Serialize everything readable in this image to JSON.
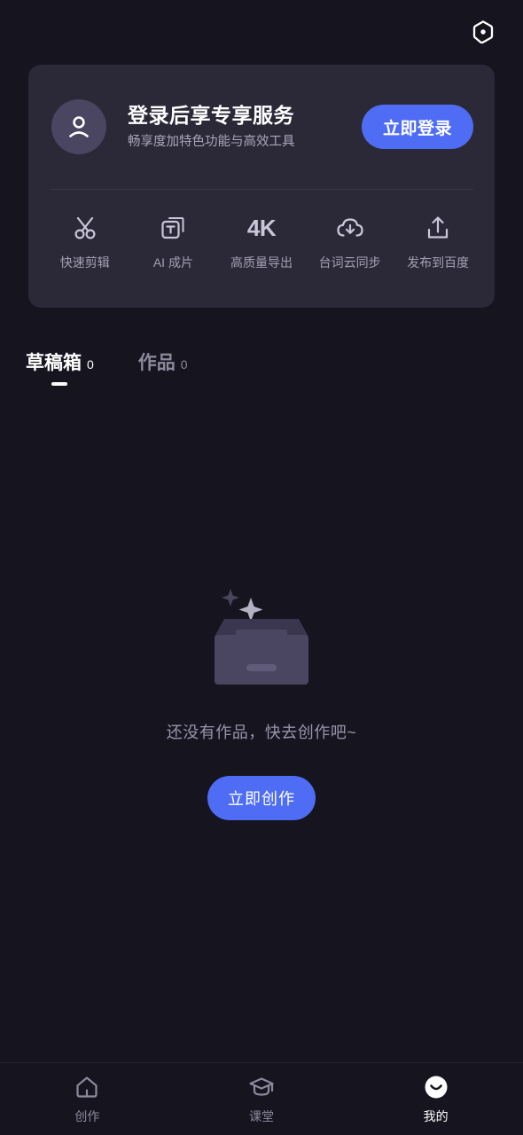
{
  "header": {
    "settings_icon": "settings-hexagon-icon"
  },
  "login_card": {
    "avatar_icon": "user-avatar-icon",
    "title": "登录后享专享服务",
    "subtitle": "畅享度加特色功能与高效工具",
    "login_button": "立即登录",
    "features": [
      {
        "icon": "scissors-icon",
        "label": "快速剪辑"
      },
      {
        "icon": "ai-text-frame-icon",
        "label": "AI 成片"
      },
      {
        "icon": "4k-icon",
        "label": "4K",
        "text": "4K",
        "caption": "高质量导出"
      },
      {
        "icon": "cloud-download-icon",
        "label": "台词云同步"
      },
      {
        "icon": "upload-icon",
        "label": "发布到百度"
      }
    ]
  },
  "tabs": [
    {
      "label": "草稿箱",
      "count": "0",
      "active": true
    },
    {
      "label": "作品",
      "count": "0",
      "active": false
    }
  ],
  "empty_state": {
    "illustration": "empty-box-sparkles-icon",
    "message": "还没有作品，快去创作吧~",
    "action_button": "立即创作"
  },
  "bottom_nav": [
    {
      "icon": "home-icon",
      "label": "创作",
      "active": false
    },
    {
      "icon": "graduation-cap-icon",
      "label": "课堂",
      "active": false
    },
    {
      "icon": "smiley-face-icon",
      "label": "我的",
      "active": true
    }
  ],
  "colors": {
    "background": "#16141f",
    "card": "#2b2937",
    "accent_blue": "#4f6df4",
    "text_primary": "#ffffff",
    "text_secondary": "#a3a0b5",
    "avatar_bg": "#4a4560"
  }
}
